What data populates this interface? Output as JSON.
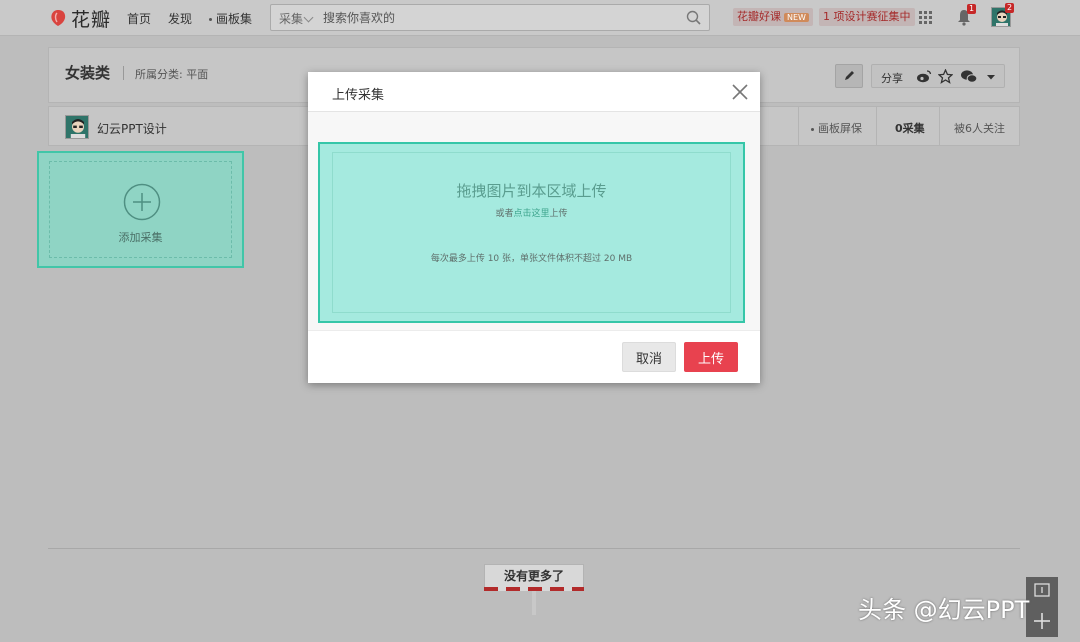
{
  "nav": {
    "logo_text": "花瓣",
    "home": "首页",
    "discover": "发现",
    "boards": "画板集",
    "search_scope": "采集",
    "search_placeholder": "搜索你喜欢的",
    "promo_course": "花瓣好课",
    "promo_course_badge": "NEW",
    "promo_contest": "1 项设计赛征集中",
    "notifications_count": "1",
    "messages_count": "2"
  },
  "board": {
    "title": "女装类",
    "category": "所属分类: 平面",
    "share_label": "分享",
    "owner_name": "幻云PPT设计",
    "stat_screensaver": "画板屏保",
    "stat_pins": "0采集",
    "stat_followers": "被6人关注"
  },
  "add_card": {
    "label": "添加采集"
  },
  "modal": {
    "title": "上传采集",
    "drop_title": "拖拽图片到本区域上传",
    "drop_sub_prefix": "或者",
    "drop_sub_link": "点击这里",
    "drop_sub_suffix": "上传",
    "drop_hint": "每次最多上传 10 张，单张文件体积不超过 20 MB",
    "cancel": "取消",
    "upload": "上传"
  },
  "footer": {
    "no_more": "没有更多了"
  },
  "watermark": "头条 @幻云PPT",
  "colors": {
    "accent_red": "#e8424f",
    "teal": "#35c6a8",
    "dropzone_bg": "#a5eadf"
  }
}
